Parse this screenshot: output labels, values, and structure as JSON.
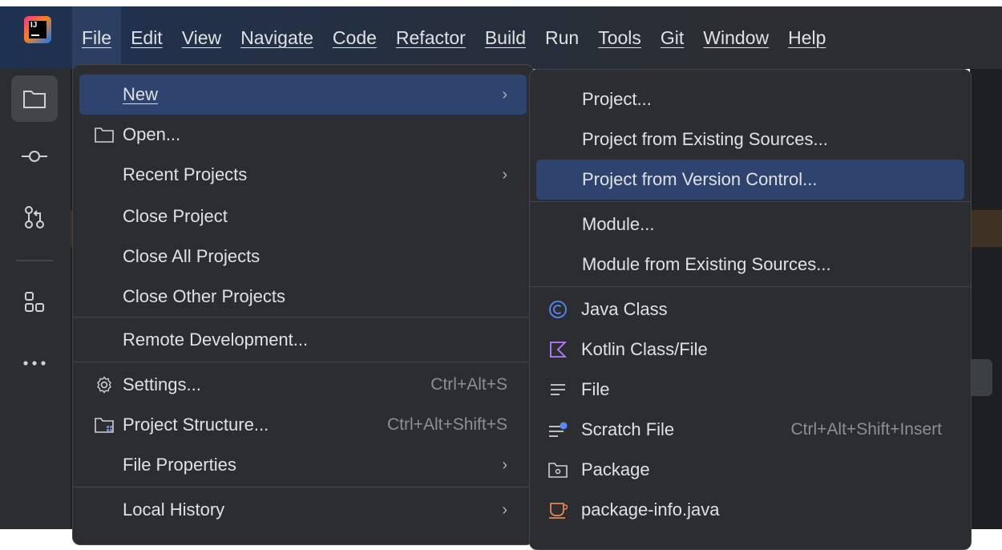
{
  "menubar": {
    "items": [
      "File",
      "Edit",
      "View",
      "Navigate",
      "Code",
      "Refactor",
      "Build",
      "Run",
      "Tools",
      "Git",
      "Window",
      "Help"
    ],
    "active": "File"
  },
  "sidebar": {
    "icons": [
      "folder-icon",
      "commit-icon",
      "pull-request-icon",
      "structure-icon",
      "more-icon"
    ]
  },
  "file_menu": {
    "items": [
      {
        "label": "New",
        "submenu": true,
        "highlighted": true
      },
      {
        "label": "Open...",
        "icon": "folder-icon"
      },
      {
        "label": "Recent Projects",
        "submenu": true
      },
      {
        "label": "Close Project"
      },
      {
        "label": "Close All Projects"
      },
      {
        "label": "Close Other Projects"
      },
      {
        "label": "Remote Development..."
      },
      {
        "label": "Settings...",
        "icon": "gear-icon",
        "shortcut": "Ctrl+Alt+S"
      },
      {
        "label": "Project Structure...",
        "icon": "project-structure-icon",
        "shortcut": "Ctrl+Alt+Shift+S"
      },
      {
        "label": "File Properties",
        "submenu": true
      },
      {
        "label": "Local History",
        "submenu": true
      }
    ]
  },
  "new_submenu": {
    "items": [
      {
        "label": "Project..."
      },
      {
        "label": "Project from Existing Sources..."
      },
      {
        "label": "Project from Version Control...",
        "highlighted": true
      },
      {
        "label": "Module..."
      },
      {
        "label": "Module from Existing Sources..."
      },
      {
        "label": "Java Class",
        "icon": "java-class-icon"
      },
      {
        "label": "Kotlin Class/File",
        "icon": "kotlin-icon"
      },
      {
        "label": "File",
        "icon": "file-icon"
      },
      {
        "label": "Scratch File",
        "icon": "scratch-file-icon",
        "shortcut": "Ctrl+Alt+Shift+Insert"
      },
      {
        "label": "Package",
        "icon": "package-icon"
      },
      {
        "label": "package-info.java",
        "icon": "package-info-icon"
      }
    ]
  },
  "colors": {
    "menu_bg": "#2b2d30",
    "highlight": "#2e436e",
    "text": "#dfe1e5",
    "shortcut": "#8c8f94",
    "java_icon": "#548af7",
    "kotlin_icon": "#b87cff",
    "package_info_icon": "#e08855"
  }
}
